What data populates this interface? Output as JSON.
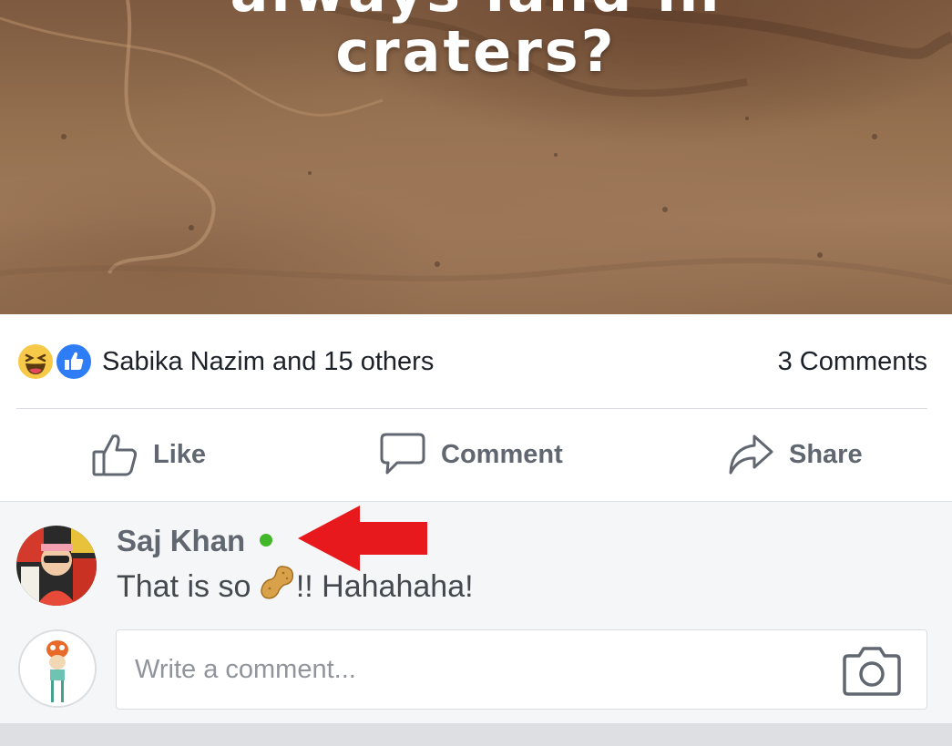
{
  "post": {
    "image_caption_line1": "always land in",
    "image_caption_line2": "craters?",
    "reaction_icons": [
      "haha-reaction-icon",
      "like-reaction-icon"
    ],
    "likers_text": "Sabika Nazim and 15 others",
    "comments_count": "3 Comments"
  },
  "actions": {
    "like_label": "Like",
    "comment_label": "Comment",
    "share_label": "Share"
  },
  "comment": {
    "author": "Saj Khan",
    "author_status": "online",
    "text_before_emoji": "That is so ",
    "emoji": "peanut-emoji",
    "text_after_emoji": "!! Hahahaha!"
  },
  "composer": {
    "placeholder": "Write a comment..."
  },
  "colors": {
    "brand_blue": "#2f7df6",
    "online_green": "#42b72a",
    "annotation_red": "#e8191c"
  }
}
